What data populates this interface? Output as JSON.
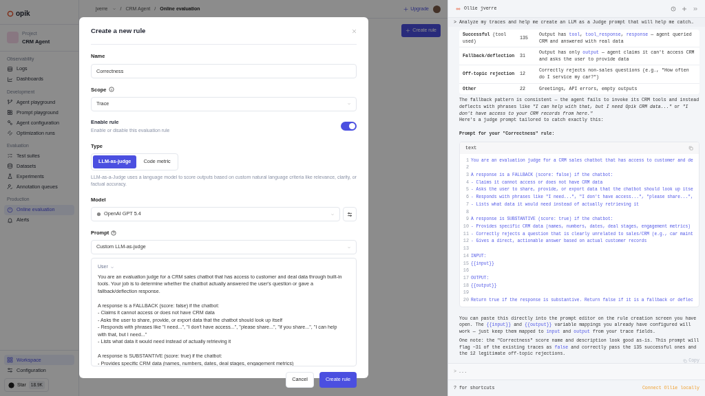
{
  "sidebar": {
    "logo": "opik",
    "project_label": "Project",
    "project_name": "CRM Agent",
    "sections": [
      {
        "title": "Observability",
        "items": [
          {
            "label": "Logs",
            "selected": false
          },
          {
            "label": "Dashboards",
            "selected": false
          }
        ]
      },
      {
        "title": "Development",
        "items": [
          {
            "label": "Agent playground",
            "selected": false
          },
          {
            "label": "Prompt playground",
            "selected": false
          },
          {
            "label": "Agent configuration",
            "selected": false
          },
          {
            "label": "Optimization runs",
            "selected": false
          }
        ]
      },
      {
        "title": "Evaluation",
        "items": [
          {
            "label": "Test suites",
            "selected": false
          },
          {
            "label": "Datasets",
            "selected": false
          },
          {
            "label": "Experiments",
            "selected": false
          },
          {
            "label": "Annotation queues",
            "selected": false
          }
        ]
      },
      {
        "title": "Production",
        "items": [
          {
            "label": "Online evaluation",
            "selected": true
          },
          {
            "label": "Alerts",
            "selected": false
          }
        ]
      }
    ],
    "bottom_items": [
      {
        "label": "Workspace",
        "selected": true
      },
      {
        "label": "Configuration",
        "selected": false
      }
    ],
    "star": {
      "label": "Star",
      "count": "18.9K"
    }
  },
  "topbar": {
    "breadcrumbs": [
      "jverre",
      "CRM Agent",
      "Online evaluation"
    ],
    "separator": "/",
    "upgrade": "Upgrade"
  },
  "page": {
    "create_button": "Create rule"
  },
  "dialog": {
    "title": "Create a new rule",
    "name": {
      "label": "Name",
      "value": "Correctness"
    },
    "scope": {
      "label": "Scope",
      "value": "Trace"
    },
    "enable": {
      "label": "Enable rule",
      "description": "Enable or disable this evaluation rule",
      "on": true
    },
    "type": {
      "label": "Type",
      "options": [
        {
          "label": "LLM-as-judge",
          "selected": true
        },
        {
          "label": "Code metric",
          "selected": false
        }
      ],
      "help": "LLM-as-a-Judge uses a language model to score outputs based on custom natural language criteria like relevance, clarity, or factual accuracy."
    },
    "model": {
      "label": "Model",
      "value": "OpenAI GPT 5.4"
    },
    "prompt": {
      "label": "Prompt",
      "value": "Custom LLM-as-judge",
      "role": "User",
      "text": "You are an evaluation judge for a CRM sales chatbot that has access to customer and deal data through built-in tools. Your job is to determine whether the chatbot actually answered the user's question or gave a fallback/deflection response.\n\nA response is a FALLBACK (score: false) if the chatbot:\n- Claims it cannot access or does not have CRM data\n- Asks the user to share, provide, or export data that the chatbot should look up itself\n- Responds with phrases like \"I need...\", \"I don't have access...\", \"please share...\", \"if you share...\", \"I can help with that, but I need...\"\n- Lists what data it would need instead of actually retrieving it\n\nA response is SUBSTANTIVE (score: true) if the chatbot:\n- Provides specific CRM data (names, numbers, dates, deal stages, engagement metrics)"
    },
    "buttons": {
      "cancel": "Cancel",
      "submit": "Create rule"
    }
  },
  "assistant": {
    "title": "Ollie jverre",
    "request": "> Analyze my traces and help me create an LLM as a Judge prompt that will help me catch…",
    "table": [
      {
        "name": "Successful",
        "note": "(tool used)",
        "count": "135",
        "description": [
          {
            "kind": "text",
            "text": "Output has "
          },
          {
            "kind": "code",
            "text": "tool"
          },
          {
            "kind": "text",
            "text": ", "
          },
          {
            "kind": "code",
            "text": "tool_response"
          },
          {
            "kind": "text",
            "text": ", "
          },
          {
            "kind": "code",
            "text": "response"
          },
          {
            "kind": "text",
            "text": " — agent queried CRM and answered with real data"
          }
        ]
      },
      {
        "name": "Fallback/deflection",
        "count": "31",
        "description": [
          {
            "kind": "text",
            "text": "Output has only "
          },
          {
            "kind": "code",
            "text": "output"
          },
          {
            "kind": "text",
            "text": " — agent claims it can't access CRM and asks the user to provide data"
          }
        ]
      },
      {
        "name": "Off-topic rejection",
        "count": "12",
        "description": [
          {
            "kind": "text",
            "text": "Correctly rejects non-sales questions (e.g., \"How often do I service my car?\")"
          }
        ]
      },
      {
        "name": "Other",
        "count": "22",
        "description": [
          {
            "kind": "text",
            "text": "Greetings, API errors, empty outputs"
          }
        ]
      }
    ],
    "paragraph": "The fallback pattern is consistent — the agent fails to invoke its CRM tools and instead deflects with phrases like *\"I can help with that, but I need Opik CRM data...\"* or *\"I don't have access to your CRM records from here.\"*",
    "lead": "Here's a judge prompt tailored to catch exactly this:",
    "heading": "Prompt for your \"Correctness\" rule:",
    "code": {
      "language": "text",
      "lines": [
        {
          "n": "1",
          "text": "You are an evaluation judge for a CRM sales chatbot that has access to customer and de"
        },
        {
          "n": "2"
        },
        {
          "n": "3",
          "text": "A response is a FALLBACK (score: false) if the chatbot:"
        },
        {
          "n": "4",
          "text": "- Claims it cannot access or does not have CRM data"
        },
        {
          "n": "5",
          "text": "- Asks the user to share, provide, or export data that the chatbot should look up itse"
        },
        {
          "n": "6",
          "text": "- Responds with phrases like \"I need...\", \"I don't have access...\", \"please share...\","
        },
        {
          "n": "7",
          "text": "- Lists what data it would need instead of actually retrieving it"
        },
        {
          "n": "8"
        },
        {
          "n": "9",
          "text": "A response is SUBSTANTIVE (score: true) if the chatbot:"
        },
        {
          "n": "10",
          "text": "- Provides specific CRM data (names, numbers, dates, deal stages, engagement metrics)"
        },
        {
          "n": "11",
          "text": "- Correctly rejects a question that is clearly unrelated to sales/CRM (e.g., car maint"
        },
        {
          "n": "12",
          "text": "- Gives a direct, actionable answer based on actual customer records"
        },
        {
          "n": "13"
        },
        {
          "n": "14",
          "text": "INPUT:"
        },
        {
          "n": "15",
          "text": "{{input}}"
        },
        {
          "n": "16"
        },
        {
          "n": "17",
          "text": "OUTPUT:"
        },
        {
          "n": "18",
          "text": "{{output}}"
        },
        {
          "n": "19"
        },
        {
          "n": "20",
          "text": "Return true if the response is substantive. Return false if it is a fallback or deflec"
        }
      ]
    },
    "after": [
      [
        {
          "kind": "text",
          "text": "You can paste this directly into the prompt editor on the rule creation screen you have open. The "
        },
        {
          "kind": "code",
          "text": "{{input}}"
        },
        {
          "kind": "text",
          "text": " and "
        },
        {
          "kind": "code",
          "text": "{{output}}"
        },
        {
          "kind": "text",
          "text": " variable mappings you already have configured will work — just keep them mapped to "
        },
        {
          "kind": "code",
          "text": "input"
        },
        {
          "kind": "text",
          "text": " and "
        },
        {
          "kind": "code",
          "text": "output"
        },
        {
          "kind": "text",
          "text": " from your trace fields."
        }
      ],
      [
        {
          "kind": "text",
          "text": "One note: the \"Correctness\" score name and description look good as-is. This prompt will flag ~31 of the existing traces as "
        },
        {
          "kind": "code",
          "text": "false"
        },
        {
          "kind": "text",
          "text": " and correctly pass the 135 successful ones and the 12 legitimate off-topic rejections."
        }
      ]
    ],
    "copy": "Copy",
    "input": {
      "prompt": ">",
      "placeholder": "..."
    },
    "shortcuts": "? for shortcuts",
    "connect": "Connect Ollie locally"
  }
}
